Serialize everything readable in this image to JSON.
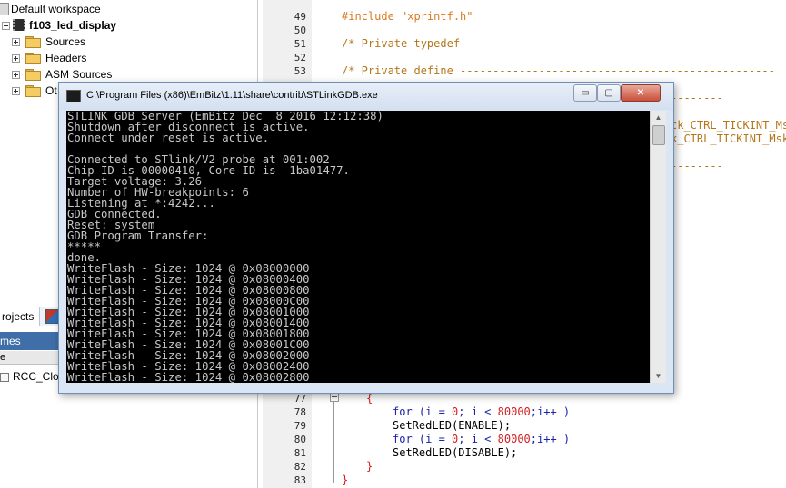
{
  "workspace": {
    "items": [
      {
        "label": "Default workspace"
      },
      {
        "label": "f103_led_display"
      },
      {
        "label": "Sources"
      },
      {
        "label": "Headers"
      },
      {
        "label": "ASM Sources"
      },
      {
        "label": "Ot"
      }
    ]
  },
  "bottom_panel": {
    "projects_tab": "rojects",
    "messages_header": "mes",
    "column_header": "e",
    "list_item": "RCC_Clocks"
  },
  "editor": {
    "lines_top": [
      {
        "n": "49",
        "code": "#include \"xprintf.h\""
      },
      {
        "n": "50",
        "code": ""
      },
      {
        "n": "51",
        "code": "/* Private typedef -----------------------------------------------"
      },
      {
        "n": "52",
        "code": ""
      },
      {
        "n": "53",
        "code": "/* Private define ------------------------------------------------"
      }
    ],
    "right_fragments": [
      "ck_CTRL_TICKINT_Ms",
      "k_CTRL_TICKINT_Msk"
    ],
    "lines_bottom": [
      {
        "n": "77",
        "code": "{"
      },
      {
        "n": "78",
        "kw": "for",
        "rest1": " (i = ",
        "num1": "0",
        "rest2": "; i < ",
        "num2": "80000",
        "rest3": ";i++ )"
      },
      {
        "n": "79",
        "code": "SetRedLED(ENABLE);"
      },
      {
        "n": "80",
        "kw": "for",
        "rest1": " (i = ",
        "num1": "0",
        "rest2": "; i < ",
        "num2": "80000",
        "rest3": ";i++ )"
      },
      {
        "n": "81",
        "code": "SetRedLED(DISABLE);"
      },
      {
        "n": "82",
        "code": "}"
      },
      {
        "n": "83",
        "code": "}"
      }
    ]
  },
  "console": {
    "title": "C:\\Program Files (x86)\\EmBitz\\1.11\\share\\contrib\\STLinkGDB.exe",
    "minimize_label": "▭",
    "maximize_label": "▢",
    "close_label": "✕",
    "lines": [
      "STLINK GDB Server (EmBitz Dec  8 2016 12:12:38)",
      "Shutdown after disconnect is active.",
      "Connect under reset is active.",
      "",
      "Connected to STlink/V2 probe at 001:002",
      "Chip ID is 00000410, Core ID is  1ba01477.",
      "Target voltage: 3.26",
      "Number of HW-breakpoints: 6",
      "Listening at *:4242...",
      "GDB connected.",
      "Reset: system",
      "GDB Program Transfer:",
      "*****",
      "done.",
      "WriteFlash - Size: 1024 @ 0x08000000",
      "WriteFlash - Size: 1024 @ 0x08000400",
      "WriteFlash - Size: 1024 @ 0x08000800",
      "WriteFlash - Size: 1024 @ 0x08000C00",
      "WriteFlash - Size: 1024 @ 0x08001000",
      "WriteFlash - Size: 1024 @ 0x08001400",
      "WriteFlash - Size: 1024 @ 0x08001800",
      "WriteFlash - Size: 1024 @ 0x08001C00",
      "WriteFlash - Size: 1024 @ 0x08002000",
      "WriteFlash - Size: 1024 @ 0x08002400",
      "WriteFlash - Size: 1024 @ 0x08002800"
    ]
  },
  "icons": {
    "workspace": "workspace-icon",
    "project": "chip-icon",
    "folder": "folder-icon",
    "console": "console-icon"
  },
  "colors": {
    "preprocessor": "#d97a1f",
    "keyword": "#1a23a6",
    "number": "#d21f1f",
    "console_bg": "#000000",
    "console_fg": "#c7c7c7"
  }
}
